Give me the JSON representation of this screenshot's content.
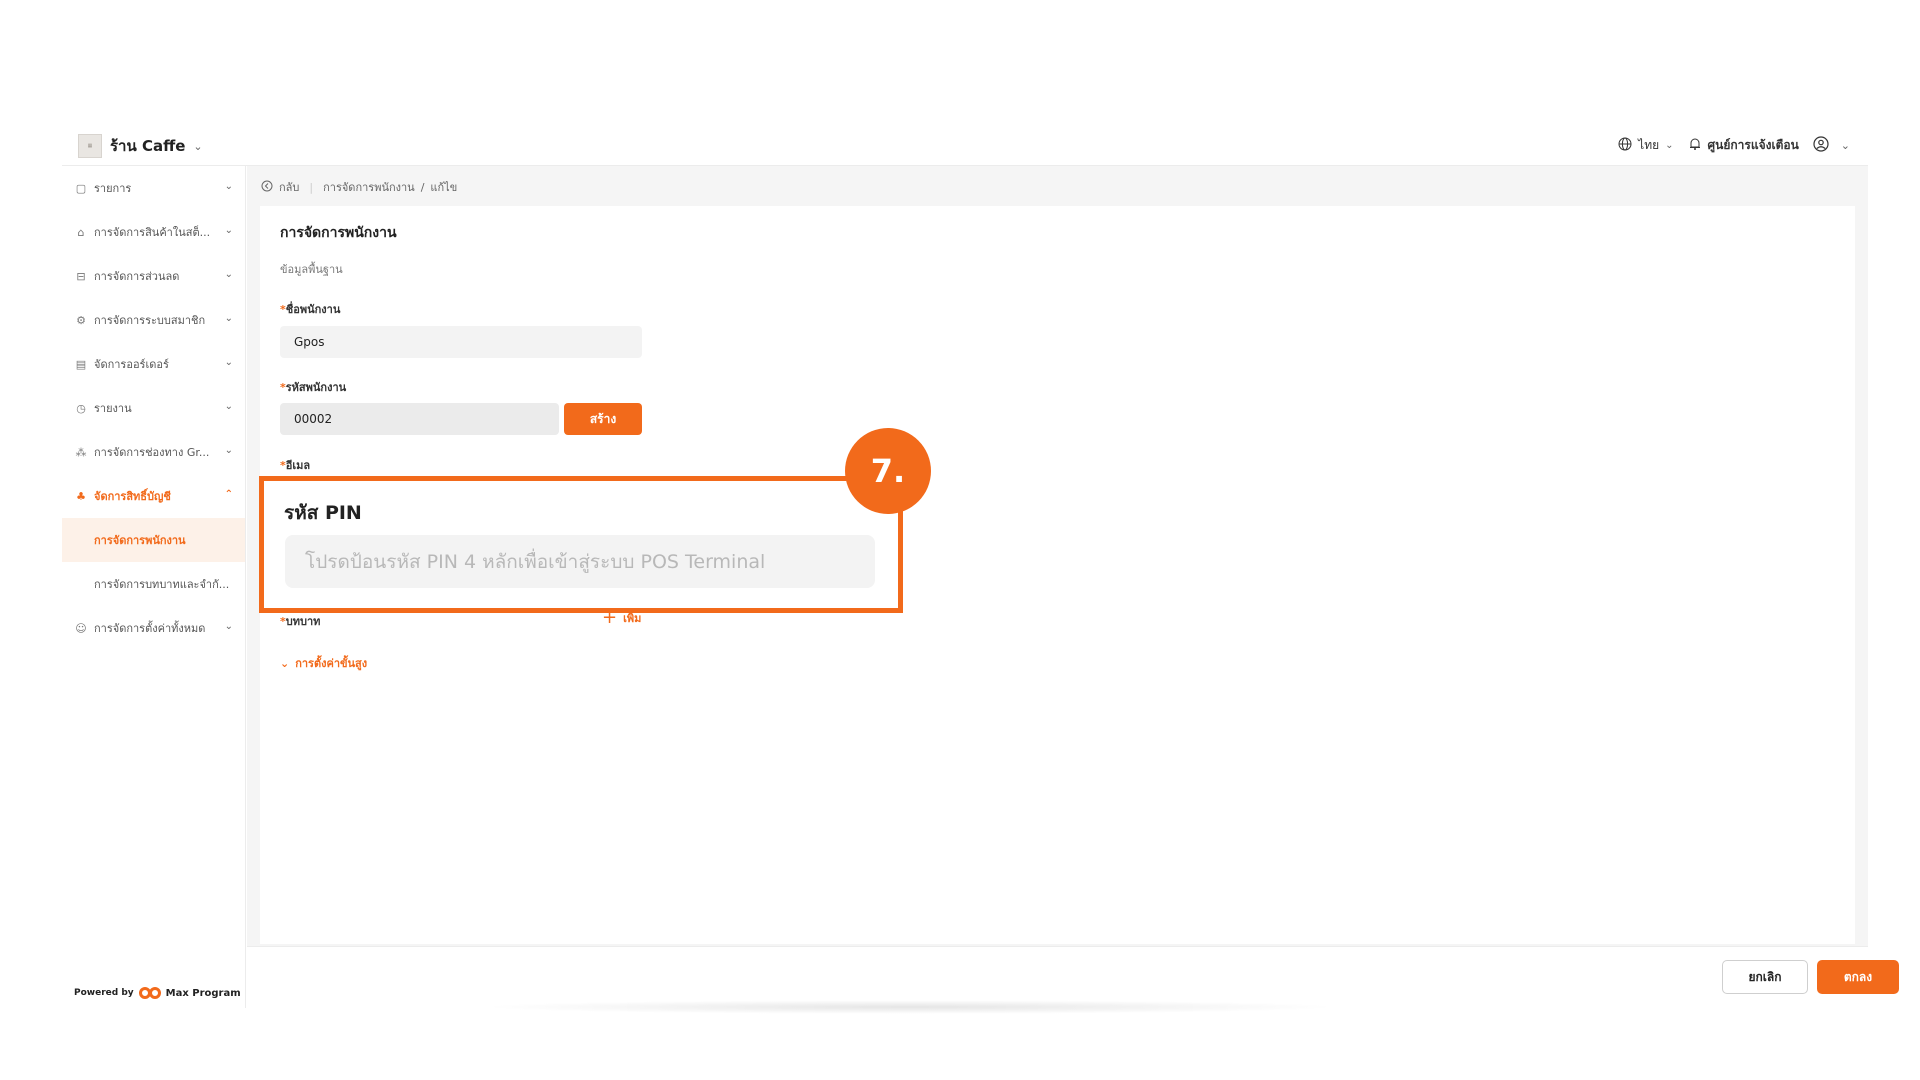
{
  "header": {
    "store_name": "ร้าน Caffe",
    "language": "ไทย",
    "notifications": "ศูนย์การแจ้งเตือน"
  },
  "sidebar": {
    "items": [
      {
        "label": "รายการ",
        "icon": "list-icon"
      },
      {
        "label": "การจัดการสินค้าในสต็...",
        "icon": "store-icon"
      },
      {
        "label": "การจัดการส่วนลด",
        "icon": "discount-icon"
      },
      {
        "label": "การจัดการระบบสมาชิก",
        "icon": "member-icon"
      },
      {
        "label": "จัดการออร์เดอร์",
        "icon": "order-icon"
      },
      {
        "label": "รายงาน",
        "icon": "report-icon"
      },
      {
        "label": "การจัดการช่องทาง Gr...",
        "icon": "channel-icon"
      },
      {
        "label": "จัดการสิทธิ์บัญชี",
        "icon": "account-icon"
      }
    ],
    "sub_items": [
      "การจัดการพนักงาน",
      "การจัดการบทบาทและจำกั..."
    ],
    "last_item": {
      "label": "การจัดการตั้งค่าทั้งหมด",
      "icon": "settings-icon"
    },
    "powered_by": "Powered by",
    "brand": "Max Program"
  },
  "breadcrumb": {
    "back": "กลับ",
    "path1": "การจัดการพนักงาน",
    "separator": "/",
    "path2": "แก้ไข"
  },
  "form": {
    "title": "การจัดการพนักงาน",
    "section": "ข้อมูลพื้นฐาน",
    "name_label": "ชื่อพนักงาน",
    "name_value": "Gpos",
    "code_label": "รหัสพนักงาน",
    "code_value": "00002",
    "create_button": "สร้าง",
    "email_label": "อีเมล",
    "role_label": "บทบาท",
    "add_button": "เพิ่ม",
    "advanced": "การตั้งค่าขั้นสูง",
    "required_mark": "*"
  },
  "footer": {
    "cancel": "ยกเลิก",
    "ok": "ตกลง"
  },
  "callout": {
    "step": "7.",
    "title": "รหัส PIN",
    "placeholder": "โปรดป้อนรหัส PIN 4 หลักเพื่อเข้าสู่ระบบ POS Terminal"
  },
  "colors": {
    "accent": "#f26a1b",
    "background": "#f5f5f5"
  }
}
